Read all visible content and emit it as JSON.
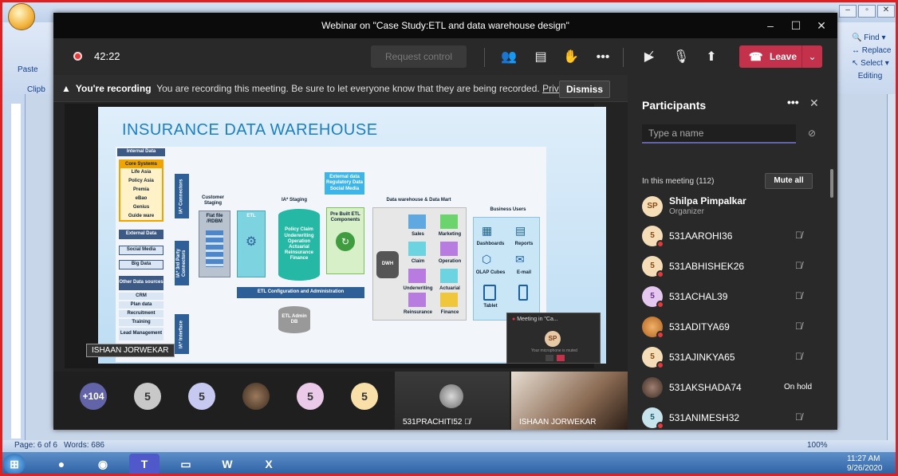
{
  "word": {
    "paste_label": "Paste",
    "clipboard_label": "Clipb",
    "editing": {
      "find": "Find",
      "replace": "Replace",
      "select": "Select",
      "group": "Editing"
    },
    "status": {
      "page": "Page: 6 of 6",
      "words": "Words: 686",
      "zoom": "100%"
    }
  },
  "taskbar": {
    "time": "11:27 AM",
    "date": "9/26/2020"
  },
  "teams": {
    "title": "Webinar on \"Case Study:ETL and data warehouse design\"",
    "timer": "42:22",
    "request_control": "Request control",
    "leave_label": "Leave",
    "recording_banner": {
      "bold": "You're recording",
      "text": "You are recording this meeting. Be sure to let everyone know that they are being recorded.",
      "link": "Priva...",
      "dismiss": "Dismiss"
    },
    "slide": {
      "title": "INSURANCE DATA WAREHOUSE",
      "presenter_tag": "ISHAAN JORWEKAR",
      "labels": {
        "internal_data": "Internal Data",
        "core_systems": "Core Systems",
        "core_items": [
          "Life Asia",
          "Policy Asia",
          "Premia",
          "eBao",
          "Genius",
          "Guide ware"
        ],
        "external_data": "External Data",
        "social_media": "Social Media",
        "big_data": "Big Data",
        "other_sources": "Other Data sources",
        "other_items": [
          "CRM",
          "Plan data",
          "Recruitment",
          "Training",
          "Lead Management"
        ],
        "ia_connectors": "IA* Connectors",
        "ia_3rd": "IA* 3rd Party Connectors",
        "ia_interface": "IA* Interface",
        "customer_staging": "Customer Staging",
        "flat_file": "Flat file /RDBM",
        "etl": "ETL",
        "ia_staging": "IA* Staging",
        "staging_items": "Policy Claim Underwriting Operation Actuarial Reinsurance Finance",
        "external_data2": "External data Regulatory Data Social Media",
        "prebuilt": "Pre Built ETL Components",
        "dw_mart": "Data warehouse & Data Mart",
        "dwh": "DWH",
        "marts": [
          "Sales",
          "Marketing",
          "Claim",
          "Operation",
          "Underwriting",
          "Actuarial",
          "Reinsurance",
          "Finance"
        ],
        "business_users": "Business Users",
        "users": [
          "Dashboards",
          "Reports",
          "OLAP Cubes",
          "E-mail",
          "Tablet",
          "Mobile"
        ],
        "etl_config": "ETL Configuration and Administration",
        "etl_admin": "ETL Admin DB"
      }
    },
    "mini_window": {
      "title": "Meeting in \"Ca...",
      "initials": "SP",
      "caption": "Your microphone is muted"
    },
    "gallery": {
      "overflow": "+104",
      "tiles": [
        "5",
        "5",
        "5",
        "5"
      ],
      "prachiti": "531PRACHITI52",
      "ishaan": "ISHAAN JORWEKAR"
    },
    "participants": {
      "title": "Participants",
      "search_placeholder": "Type a name",
      "section": "In this meeting (112)",
      "mute_all": "Mute all",
      "organizer": {
        "initials": "SP",
        "name": "Shilpa Pimpalkar",
        "role": "Organizer"
      },
      "list": [
        {
          "initial": "5",
          "name": "531AAROHI36"
        },
        {
          "initial": "5",
          "name": "531ABHISHEK26"
        },
        {
          "initial": "5",
          "name": "531ACHAL39"
        },
        {
          "initial": "",
          "name": "531ADITYA69"
        },
        {
          "initial": "5",
          "name": "531AJINKYA65"
        },
        {
          "initial": "",
          "name": "531AKSHADA74",
          "status": "On hold"
        },
        {
          "initial": "5",
          "name": "531ANIMESH32"
        }
      ]
    }
  }
}
